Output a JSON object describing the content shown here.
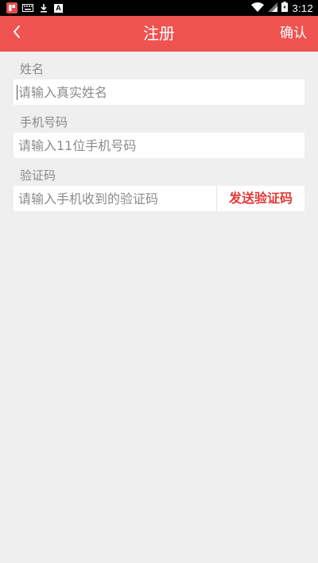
{
  "status_bar": {
    "time": "3:12",
    "notification_icons": [
      "app-notification-icon",
      "keyboard-icon",
      "download-icon",
      "text-a-icon"
    ],
    "system_icons": [
      "wifi-icon",
      "signal-icon",
      "battery-icon"
    ]
  },
  "app_bar": {
    "back_icon": "chevron-left-icon",
    "title": "注册",
    "confirm_label": "确认",
    "background_color": "#ef5350"
  },
  "form": {
    "name": {
      "label": "姓名",
      "placeholder": "请输入真实姓名",
      "value": ""
    },
    "phone": {
      "label": "手机号码",
      "placeholder": "请输入11位手机号码",
      "value": ""
    },
    "code": {
      "label": "验证码",
      "placeholder": "请输入手机收到的验证码",
      "value": "",
      "send_button_label": "发送验证码",
      "send_button_color": "#e53935"
    }
  }
}
